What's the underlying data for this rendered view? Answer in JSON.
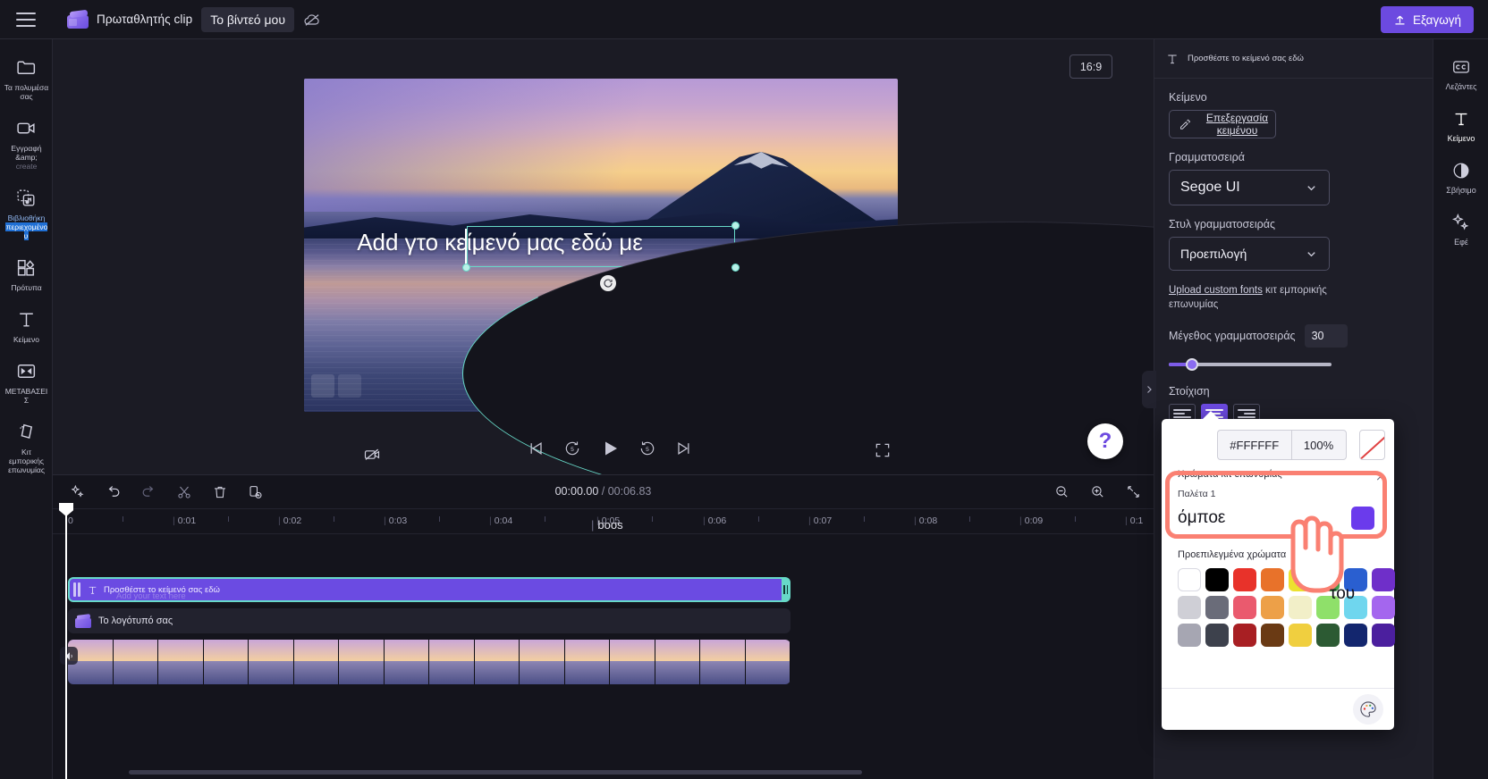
{
  "topbar": {
    "brand": "Πρωταθλητής clip",
    "project_name": "Το βίντεό μου",
    "cloud_icon": "cloud-off-icon",
    "menu_icon": "hamburger-menu-icon",
    "export_label": "Εξαγωγή",
    "export_icon": "upload-icon",
    "accent": "#6c4ae0"
  },
  "sidebar": {
    "items": [
      {
        "label": "Τα πολυμέσα σας",
        "icon": "folder-icon",
        "sub": ""
      },
      {
        "label": "Εγγραφή &amp;",
        "icon": "video-camera-icon",
        "sub": "create"
      },
      {
        "label": "Βιβλιοθήκη",
        "icon": "content-library-icon",
        "sub": "περιεχομένου",
        "highlight": true
      },
      {
        "label": "Πρότυπα",
        "icon": "templates-icon",
        "sub": ""
      },
      {
        "label": "Κείμενο",
        "icon": "text-icon",
        "sub": ""
      },
      {
        "label": "ΜΕΤΑΒΑΣΕΙΣ",
        "icon": "transitions-icon",
        "sub": ""
      },
      {
        "label": "Κιτ εμπορικής επωνυμίας",
        "icon": "brand-kit-icon",
        "sub": ""
      }
    ]
  },
  "stage": {
    "aspect_ratio": "16:9",
    "canvas_text": "Add γτο κείμενό μας εδώ με",
    "magic_icon": "magic-wand-icon",
    "fullscreen_icon": "fullscreen-icon",
    "help_icon": "question-mark-icon",
    "collapse_icon": "chevron-down-icon",
    "controls": [
      {
        "name": "skip-start",
        "icon": "skip-to-start-icon"
      },
      {
        "name": "back-5",
        "icon": "rewind-5-icon",
        "badge": "5"
      },
      {
        "name": "play",
        "icon": "play-icon"
      },
      {
        "name": "forward-5",
        "icon": "forward-5-icon",
        "badge": "5"
      },
      {
        "name": "skip-end",
        "icon": "skip-to-end-icon"
      }
    ]
  },
  "timeline": {
    "toolbar": [
      {
        "name": "ai-tools",
        "icon": "sparkle-icon"
      },
      {
        "name": "undo",
        "icon": "undo-arrow-icon"
      },
      {
        "name": "redo",
        "icon": "redo-arrow-icon"
      },
      {
        "name": "split",
        "icon": "scissors-icon"
      },
      {
        "name": "delete",
        "icon": "trash-icon"
      },
      {
        "name": "duplicate",
        "icon": "duplicate-icon"
      }
    ],
    "current_time": "00:00.00",
    "total_time": "/ 00:06.83",
    "zoom_out_icon": "zoom-out-icon",
    "zoom_in_icon": "zoom-in-icon",
    "fit_icon": "fit-to-timeline-icon",
    "ruler_marks": [
      "0",
      "0:01",
      "0:02",
      "0:03",
      "0:04",
      "0:05",
      "0:06",
      "0:07",
      "0:08",
      "0:09",
      "0:1"
    ],
    "marker_label": "boos",
    "tracks": [
      {
        "name": "text-clip",
        "label": "Προσθέστε το κείμενό σας εδώ",
        "ghost_label": "Add your text here",
        "icon": "text-icon",
        "color": "#6b4be2",
        "selected": true
      },
      {
        "name": "logo-clip",
        "label": "Το λογότυπό σας",
        "icon": "logo-icon",
        "color": "#22222e"
      },
      {
        "name": "video-clip",
        "label": "",
        "icon": "speaker-icon"
      }
    ]
  },
  "right_panel": {
    "header_text": "Προσθέστε το κείμενό σας εδώ",
    "header_icon": "text-icon",
    "sections": {
      "text_label": "Κείμενο",
      "edit_text_button": "Επεξεργασία κειμένου",
      "edit_text_icon": "edit-pencil-icon",
      "font_label": "Γραμματοσειρά",
      "font_value": "Segoe UI",
      "font_style_label": "Στυλ γραμματοσειράς",
      "font_style_value": "Προεπιλογή",
      "upload_link": "Upload custom fonts",
      "upload_rest": " κιτ εμπορικής επωνυμίας",
      "font_size_label": "Μέγεθος γραμματοσειράς",
      "font_size_value": "30",
      "align_label": "Στοίχιση"
    },
    "collapse_icon": "chevron-right-icon"
  },
  "right_rail": {
    "items": [
      {
        "label": "Λεζάντες",
        "icon": "captions-icon",
        "active": false
      },
      {
        "label": "Κείμενο",
        "icon": "text-icon",
        "active": true
      },
      {
        "label": "Σβήσιμο",
        "icon": "fade-icon",
        "active": false
      },
      {
        "label": "Εφέ",
        "icon": "effects-icon",
        "active": false
      }
    ]
  },
  "color_popover": {
    "hex_value": "#FFFFFF",
    "opacity_value": "100%",
    "none_swatch": "no-color-icon",
    "brand_colors_label": "Χρώματα κιτ επωνυμίας",
    "palette_label": "Παλέτα 1",
    "palette_name": "όμποε",
    "palette_swatch": "#6b3bec",
    "presets_label": "Προεπιλεγμένα χρώματα",
    "collapse_icon": "chevron-up-icon",
    "palette_fab_icon": "color-palette-icon",
    "preset_rows": [
      [
        "#ffffff",
        "#000000",
        "#e8322a",
        "#e8722a",
        "#ece12f",
        "#3f9b4a",
        "#2a5fd0",
        "#6f2fc9"
      ],
      [
        "#cfcfd6",
        "#6a6c79",
        "#ea5a6e",
        "#eda048",
        "#f2efc8",
        "#8fe06a",
        "#6fd6ee",
        "#a466ee"
      ],
      [
        "#a6a6b2",
        "#3d414c",
        "#a81f23",
        "#6a3a14",
        "#f0cf3f",
        "#2c5a33",
        "#13266e",
        "#4b1f9e"
      ]
    ],
    "annotation_color": "#fa8072",
    "tooltip_text": "του"
  }
}
